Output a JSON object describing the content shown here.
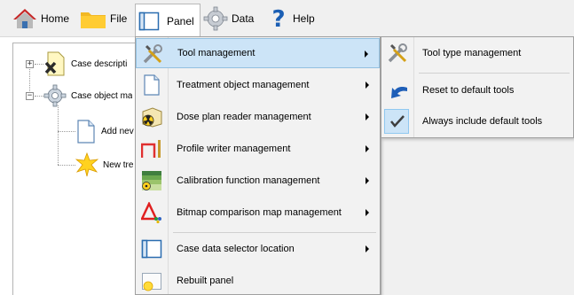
{
  "menubar": {
    "items": [
      {
        "label": "Home",
        "icon": "home-icon"
      },
      {
        "label": "File",
        "icon": "folder-icon"
      },
      {
        "label": "Panel",
        "icon": "panel-icon"
      },
      {
        "label": "Data",
        "icon": "gear-icon"
      },
      {
        "label": "Help",
        "icon": "help-icon"
      }
    ],
    "open_menu": "Panel"
  },
  "tree": {
    "nodes": [
      {
        "label": "Case descripti",
        "icon": "document-x-icon",
        "expander": "+"
      },
      {
        "label": "Case object ma",
        "icon": "gear-icon",
        "expander": "−"
      },
      {
        "label": "Add nev",
        "icon": "blank-document-icon"
      },
      {
        "label": "New tre",
        "icon": "star-burst-icon"
      }
    ]
  },
  "panel_menu": {
    "items": [
      {
        "label": "Tool management",
        "icon": "tools-icon",
        "submenu": true,
        "highlighted": true
      },
      {
        "label": "Treatment object management",
        "icon": "blank-document-icon",
        "submenu": true
      },
      {
        "label": "Dose plan reader management",
        "icon": "radiation-book-icon",
        "submenu": true
      },
      {
        "label": "Profile writer management",
        "icon": "profile-pulse-icon",
        "submenu": true
      },
      {
        "label": "Calibration function management",
        "icon": "calibration-icon",
        "submenu": true
      },
      {
        "label": "Bitmap comparison map management",
        "icon": "delta-icon",
        "submenu": true
      },
      {
        "label": "Case data selector location",
        "icon": "panel-icon",
        "submenu": true
      },
      {
        "label": "Rebuilt panel",
        "icon": "rebuild-panel-icon",
        "submenu": false
      }
    ]
  },
  "tool_submenu": {
    "items": [
      {
        "label": "Tool type management",
        "icon": "tools-icon"
      },
      {
        "label": "Reset to default tools",
        "icon": "reset-arrow-icon"
      },
      {
        "label": "Always include default tools",
        "icon": "checkmark-icon",
        "checked": true
      }
    ]
  },
  "colors": {
    "highlight": "#cce4f7",
    "highlight_border": "#92c0e0",
    "menubar_bg": "#f0f0f0",
    "reset_arrow": "#1f5fb8",
    "delta_red": "#e02020"
  }
}
